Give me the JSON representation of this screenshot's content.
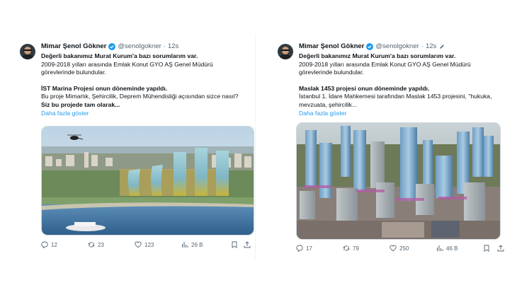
{
  "tweets": [
    {
      "author": {
        "name": "Mimar Şenol Gökner",
        "handle": "@senolgokner",
        "time": "12s"
      },
      "lines": {
        "l1": "Değerli bakanımız Murat Kurum'a bazı sorumlarım var.",
        "l2": "2009-2018 yılları arasında Emlak Konut GYO AŞ Genel Müdürü",
        "l3": "görevlerinde bulundular.",
        "l4": "İST Marina Projesi onun döneminde yapıldı.",
        "l5": "Bu proje Mimarlık, Şehircilik, Deprem Mühendisliği açısından sizce nasıl?",
        "l6": "Siz bu projede tam olarak..."
      },
      "show_more": "Daha fazla göster",
      "stats": {
        "replies": "12",
        "retweets": "23",
        "likes": "123",
        "views": "26 B"
      }
    },
    {
      "author": {
        "name": "Mimar Şenol Gökner",
        "handle": "@senolgokner",
        "time": "12s"
      },
      "lines": {
        "l1": "Değerli bakanımız Murat Kurum'a bazı sorumlarım var.",
        "l2": "2009-2018 yılları arasında Emlak Konut GYO AŞ Genel Müdürü",
        "l3": "görevlerinde bulundular.",
        "l4": "Maslak 1453 projesi onun döneminde yapıldı.",
        "l5": "İstanbul 1. İdare Mahkemesi tarafından   Maslak 1453 projesini, \"hukuka,",
        "l6": "mevzuata, şehircilik..."
      },
      "show_more": "Daha fazla göster",
      "stats": {
        "replies": "17",
        "retweets": "79",
        "likes": "250",
        "views": "46 B"
      }
    }
  ],
  "colors": {
    "accent": "#1d9bf0",
    "muted": "#536471",
    "text": "#0f1419"
  },
  "icons": [
    "verified-badge-icon",
    "edit-icon",
    "reply-icon",
    "retweet-icon",
    "like-icon",
    "views-icon",
    "bookmark-icon",
    "share-icon"
  ]
}
